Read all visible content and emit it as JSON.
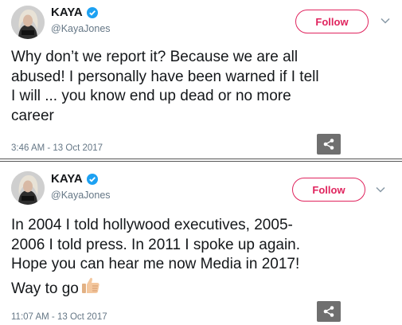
{
  "tweets": [
    {
      "name": "KAYA",
      "handle": "@KayaJones",
      "follow_label": "Follow",
      "text_lines": [
        "Why don’t we report it? Because we are all",
        "abused! I personally have been warned if I tell",
        "I will ... you know end up dead or no more",
        "career"
      ],
      "timestamp": "3:46 AM - 13 Oct 2017"
    },
    {
      "name": "KAYA",
      "handle": "@KayaJones",
      "follow_label": "Follow",
      "text_lines": [
        "In 2004 I told hollywood executives, 2005-",
        "2006 I told press. In 2011 I spoke up again.",
        "Hope you can hear me now Media in 2017!",
        "Way to go"
      ],
      "timestamp": "11:07 AM - 13 Oct 2017",
      "emoji": "thumbs-up-emoji"
    }
  ],
  "avatar_label": "Kaya",
  "colors": {
    "follow": "#e0245e",
    "verified": "#1da1f2",
    "meta": "#657786",
    "share_bg": "#6f6f6f"
  },
  "icons": [
    "verified-badge-icon",
    "chevron-down-icon",
    "share-icon",
    "thumbs-up-emoji"
  ]
}
